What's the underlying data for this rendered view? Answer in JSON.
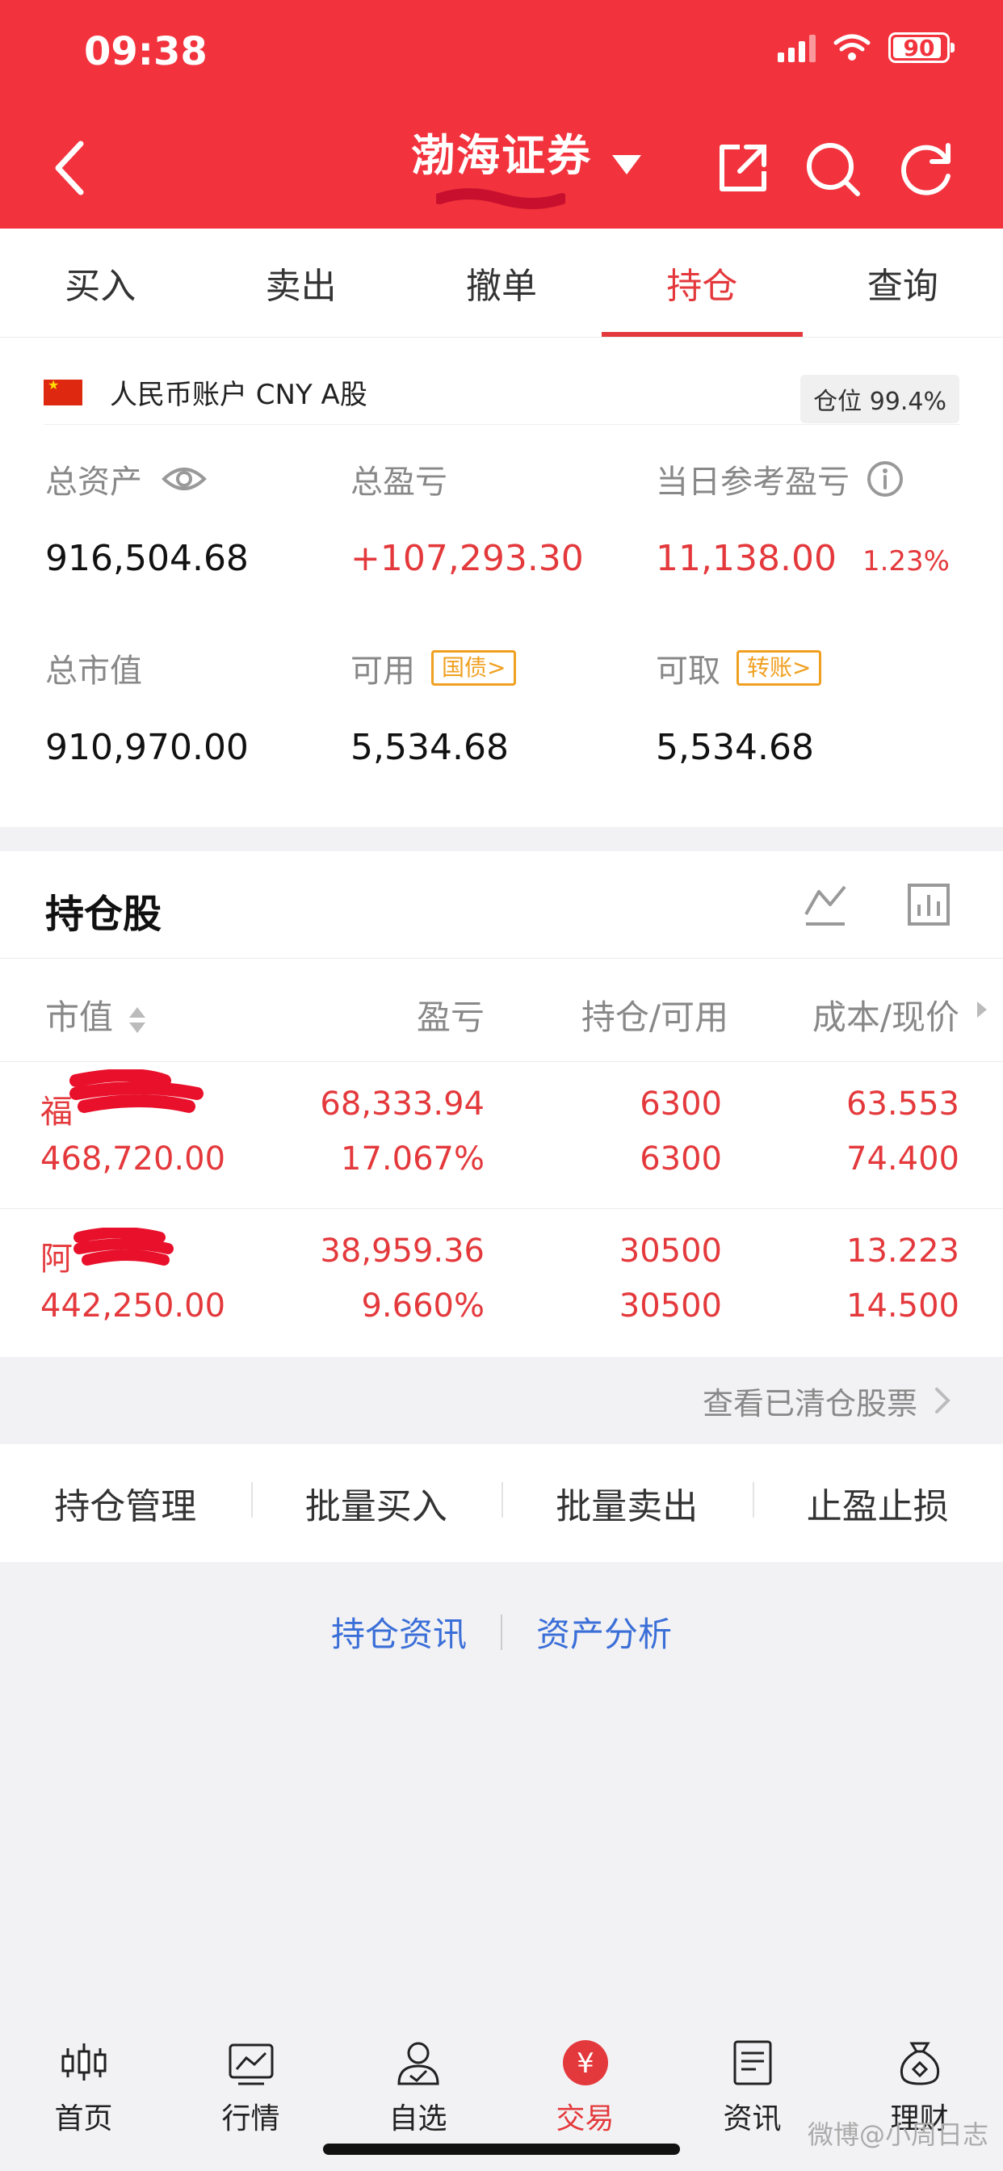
{
  "status": {
    "time": "09:38",
    "battery": "90"
  },
  "header": {
    "title": "渤海证券"
  },
  "tabs": [
    {
      "label": "买入"
    },
    {
      "label": "卖出"
    },
    {
      "label": "撤单"
    },
    {
      "label": "持仓",
      "active": true
    },
    {
      "label": "查询"
    }
  ],
  "account": {
    "label": "人民币账户 CNY A股",
    "position_ratio": "仓位 99.4%",
    "total_assets_label": "总资产",
    "total_assets": "916,504.68",
    "total_pl_label": "总盈亏",
    "total_pl": "+107,293.30",
    "daily_pl_label": "当日参考盈亏",
    "daily_pl": "11,138.00",
    "daily_pl_pct": "1.23%",
    "market_value_label": "总市值",
    "market_value": "910,970.00",
    "available_label": "可用",
    "available": "5,534.68",
    "bond_tag": "国债>",
    "withdrawable_label": "可取",
    "withdrawable": "5,534.68",
    "transfer_tag": "转账>"
  },
  "holdings": {
    "title": "持仓股",
    "columns": [
      "市值",
      "盈亏",
      "持仓/可用",
      "成本/现价"
    ],
    "rows": [
      {
        "name": "福",
        "market_value": "468,720.00",
        "pl": "68,333.94",
        "pl_pct": "17.067%",
        "position": "6300",
        "available": "6300",
        "cost": "63.553",
        "price": "74.400"
      },
      {
        "name": "阿",
        "market_value": "442,250.00",
        "pl": "38,959.36",
        "pl_pct": "9.660%",
        "position": "30500",
        "available": "30500",
        "cost": "13.223",
        "price": "14.500"
      }
    ],
    "cleared_link": "查看已清仓股票"
  },
  "actions": [
    "持仓管理",
    "批量买入",
    "批量卖出",
    "止盈止损"
  ],
  "links": {
    "news": "持仓资讯",
    "analysis": "资产分析"
  },
  "nav": [
    {
      "label": "首页",
      "icon": "candlestick-icon"
    },
    {
      "label": "行情",
      "icon": "market-chart-icon"
    },
    {
      "label": "自选",
      "icon": "user-check-icon"
    },
    {
      "label": "交易",
      "icon": "yuan-icon",
      "active": true
    },
    {
      "label": "资讯",
      "icon": "news-icon"
    },
    {
      "label": "理财",
      "icon": "money-bag-icon"
    }
  ],
  "watermark": "微博@小周日志"
}
